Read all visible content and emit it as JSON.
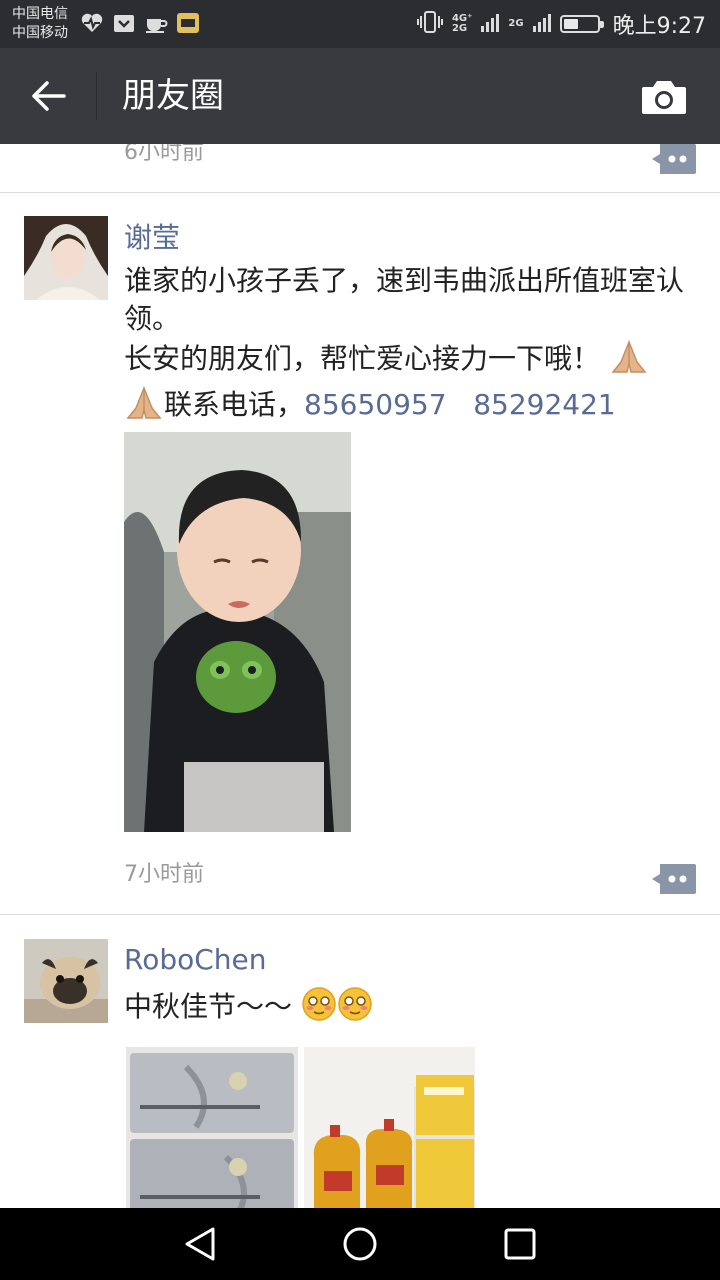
{
  "status_bar": {
    "carrier_1": "中国电信",
    "carrier_2": "中国移动",
    "network_1": "4G⁺",
    "network_1b": "2G",
    "network_2": "2G",
    "time": "晚上9:27",
    "battery_level": 0.45,
    "icons": [
      "heart-monitor-icon",
      "shopping-icon",
      "coffee-icon",
      "app-icon",
      "vibrate-icon",
      "signal-icon",
      "signal-icon",
      "battery-icon"
    ]
  },
  "header": {
    "title": "朋友圈",
    "back_icon": "arrow-left-icon",
    "camera_icon": "camera-icon"
  },
  "posts": [
    {
      "time": "6小时前"
    },
    {
      "username": "谢莹",
      "text_line_1": "谁家的小孩子丢了，速到韦曲派出所值班室认领。",
      "text_line_2": "长安的朋友们，帮忙爱心接力一下哦！",
      "text_line_3": "联系电话，",
      "phone_1": "85650957",
      "phone_2": "85292421",
      "emoji": "folded-hands-icon",
      "time": "7小时前"
    },
    {
      "username": "RoboChen",
      "text": "中秋佳节～～",
      "emoji": "flushed-face-icon"
    }
  ],
  "colors": {
    "status_bar": "#2c2d31",
    "header": "#393a3f",
    "link": "#576b95",
    "time": "#9a9a9a"
  }
}
